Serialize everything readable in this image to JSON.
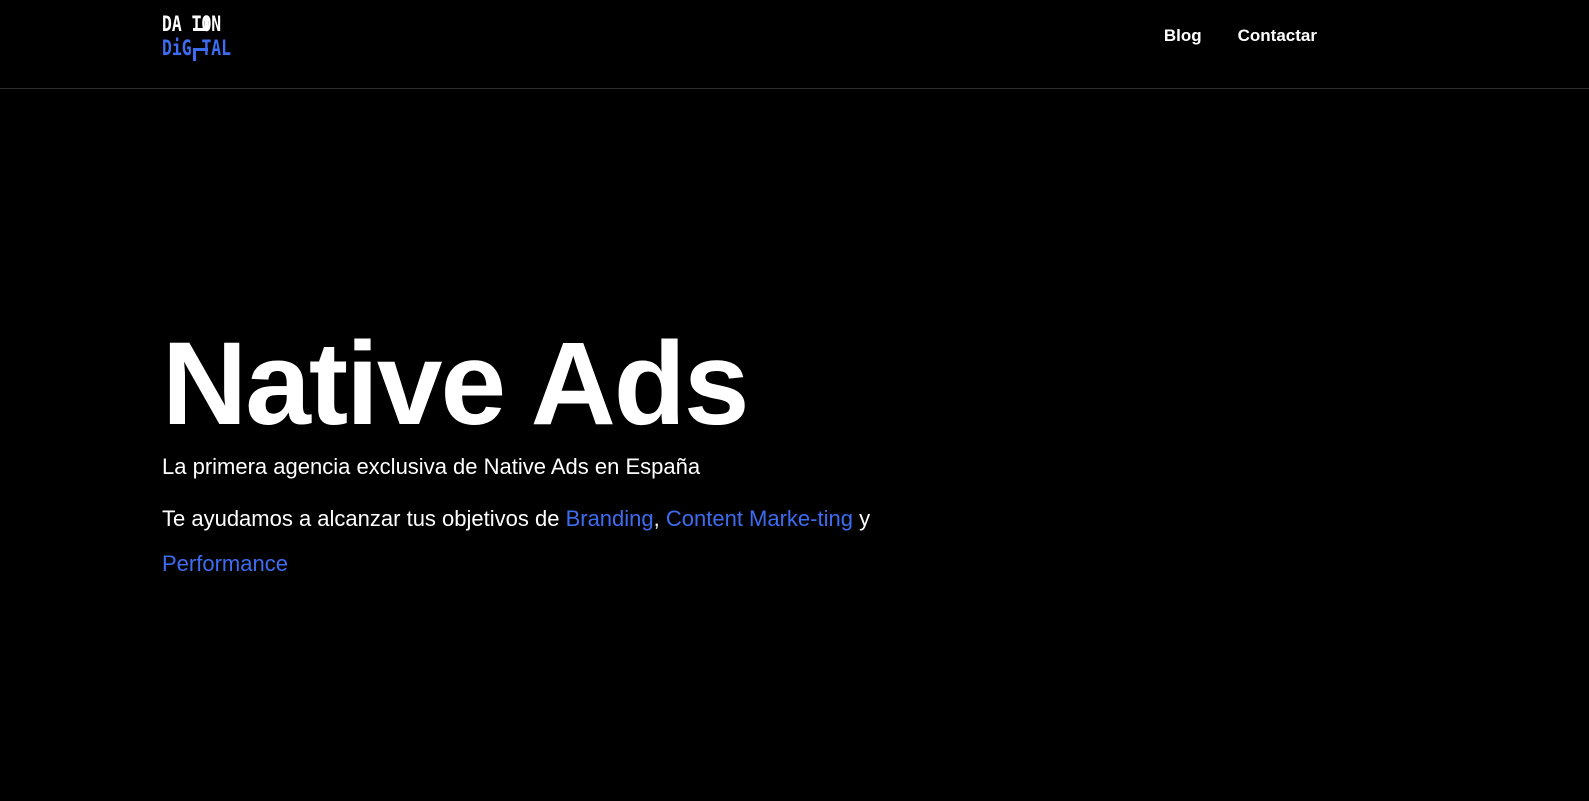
{
  "header": {
    "logo": {
      "line1": "DA TON",
      "line2": "DiG TAL",
      "accent_color": "#3d6cf0"
    },
    "nav": [
      {
        "label": "Blog"
      },
      {
        "label": "Contactar"
      }
    ]
  },
  "hero": {
    "title": "Native Ads",
    "subtitle": "La primera agencia exclusiva de Native Ads en España",
    "description": {
      "prefix": "Te ayudamos a alcanzar tus objetivos de ",
      "link1": "Branding",
      "sep1": ", ",
      "link2": "Content Marke-ting",
      "sep2": " y ",
      "link3": "Performance"
    },
    "link_color": "#3d6cf0"
  }
}
